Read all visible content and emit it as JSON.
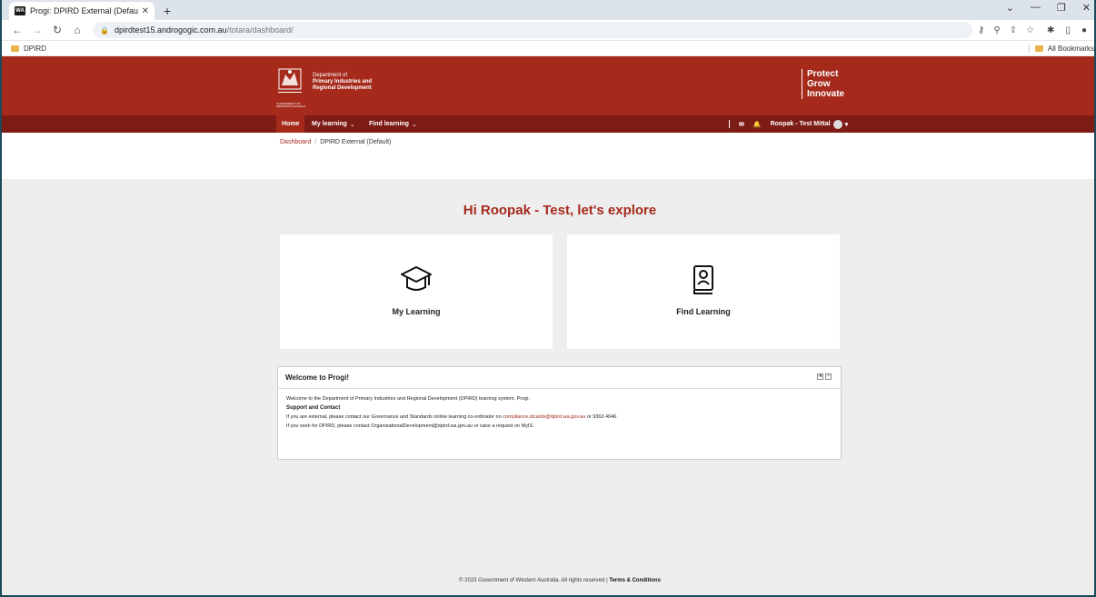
{
  "browser": {
    "tab_title": "Progi: DPIRD External (Default)",
    "tab_favicon_text": "WA",
    "url_host": "dpirdtest15.androgogic.com.au",
    "url_path": "/totara/dashboard/",
    "bookmark_folder": "DPIRD",
    "all_bookmarks": "All Bookmarks"
  },
  "header": {
    "dept_line1": "Department of",
    "dept_line2": "Primary Industries and",
    "dept_line3": "Regional Development",
    "gov_line1": "GOVERNMENT OF",
    "gov_line2": "WESTERN AUSTRALIA",
    "tagline1": "Protect",
    "tagline2": "Grow",
    "tagline3": "Innovate"
  },
  "nav": {
    "home": "Home",
    "my_learning": "My learning",
    "find_learning": "Find learning",
    "user_name": "Roopak - Test Mittal"
  },
  "breadcrumb": {
    "dashboard": "Dashboard",
    "current": "DPIRD External (Default)"
  },
  "main": {
    "greeting": "Hi Roopak - Test, let's explore",
    "card1_label": "My Learning",
    "card2_label": "Find Learning"
  },
  "block": {
    "title": "Welcome to Progi!",
    "intro": "Welcome to the Department of Primary Industries and Regional Development (DPIRD) learning system, Progi.",
    "support_heading": "Support and Contact",
    "external_text": "If you are external, please contact our Governance and Standards online learning co-ordinator on",
    "external_email": "compliance.idcards@dpird.wa.gov.au",
    "external_phone": "or 9363 4046.",
    "internal_text": "If you work for DPIRD, please contact OrganisationalDevelopment@dpird.wa.gov.au or raise a request on MyIS."
  },
  "footer": {
    "copyright": "© 2023 Government of Western Australia. All rights reserved |",
    "terms": "Terms & Conditions"
  },
  "colors": {
    "brand": "#a52a1c",
    "nav_dark": "#7d1b15",
    "background": "#eeeeee"
  }
}
